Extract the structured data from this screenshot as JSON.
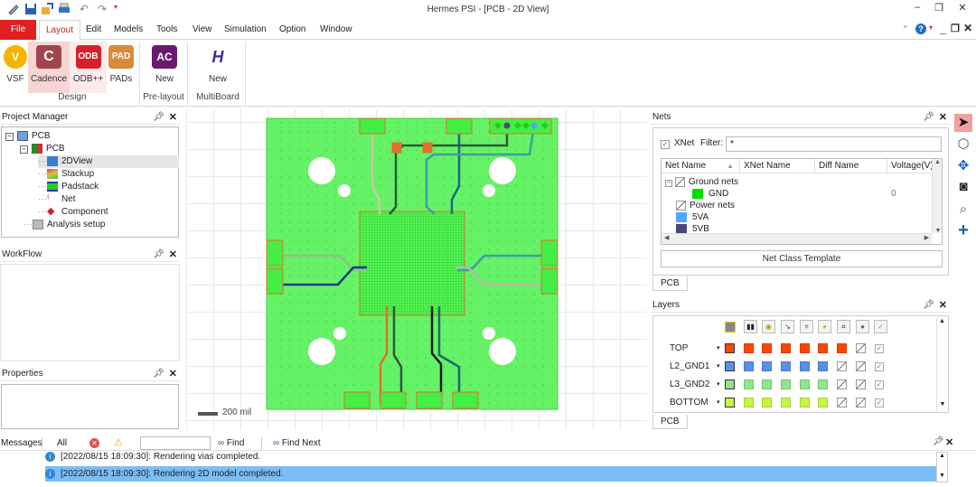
{
  "window": {
    "title": "Hermes PSI - [PCB - 2D View]",
    "minimize": "–",
    "restore": "❐",
    "close": "✕"
  },
  "quick_access": [
    "open-icon",
    "save-icon",
    "import-icon",
    "print-icon",
    "undo-icon",
    "redo-icon",
    "customize-icon"
  ],
  "menu": {
    "file": "File",
    "items": [
      "Layout",
      "Edit",
      "Models",
      "Tools",
      "View",
      "Simulation",
      "Option",
      "Window"
    ],
    "active": "Layout"
  },
  "ribbon": {
    "design": {
      "label": "Design",
      "buttons": [
        {
          "label": "VSF",
          "glyph": "V",
          "color": "#f4b400"
        },
        {
          "label": "Cadence",
          "glyph": "C",
          "color": "#a0454f"
        },
        {
          "label": "ODB++",
          "glyph": "ODB",
          "color": "#d6202a"
        },
        {
          "label": "PADs",
          "glyph": "PAD",
          "color": "#d98a3a"
        }
      ]
    },
    "prelayout": {
      "label": "Pre-layout",
      "buttons": [
        {
          "label": "New",
          "glyph": "AC",
          "color": "#6a1b6e"
        }
      ]
    },
    "multiboard": {
      "label": "MultiBoard",
      "buttons": [
        {
          "label": "New",
          "glyph": "H",
          "color": "#3a2ab0"
        }
      ]
    }
  },
  "project_manager": {
    "title": "Project Manager",
    "items": [
      {
        "label": "PCB",
        "level": 0
      },
      {
        "label": "PCB",
        "level": 1
      },
      {
        "label": "2DView",
        "level": 2,
        "selected": true
      },
      {
        "label": "Stackup",
        "level": 2
      },
      {
        "label": "Padstack",
        "level": 2
      },
      {
        "label": "Net",
        "level": 2
      },
      {
        "label": "Component",
        "level": 2
      },
      {
        "label": "Analysis setup",
        "level": 1
      }
    ]
  },
  "workflow": {
    "title": "WorkFlow"
  },
  "properties": {
    "title": "Properties"
  },
  "canvas": {
    "scale_label": "200 mil"
  },
  "nets": {
    "title": "Nets",
    "xnet_label": "XNet",
    "xnet_checked": true,
    "filter_label": "Filter:",
    "filter_value": "*",
    "columns": [
      "Net Name",
      "XNet Name",
      "Diff Name",
      "Voltage(V)"
    ],
    "rows": [
      {
        "name": "Ground nets",
        "type": "group",
        "voltage": ""
      },
      {
        "name": "GND",
        "type": "net",
        "color": "#00e000",
        "voltage": "0"
      },
      {
        "name": "Power nets",
        "type": "group",
        "voltage": ""
      },
      {
        "name": "5VA",
        "type": "net",
        "color": "#4da6ff",
        "voltage": ""
      },
      {
        "name": "5VB",
        "type": "net",
        "color": "#4a4a7a",
        "voltage": ""
      }
    ],
    "template_button": "Net Class Template",
    "tab": "PCB"
  },
  "layers": {
    "title": "Layers",
    "header_icons": [
      "layer-color-icon",
      "pad-icon",
      "via-icon",
      "trace-icon",
      "shape-icon",
      "hole-icon",
      "component-icon",
      "net-icon",
      "visible-icon"
    ],
    "rows": [
      {
        "name": "TOP",
        "color": "#ff4500",
        "filled": 7
      },
      {
        "name": "L2_GND1",
        "color": "#5b8fe6",
        "filled": 6
      },
      {
        "name": "L3_GND2",
        "color": "#8fe68f",
        "filled": 6
      },
      {
        "name": "BOTTOM",
        "color": "#c6f542",
        "filled": 6
      }
    ],
    "tab": "PCB"
  },
  "right_toolbar": [
    "select-arrow-icon",
    "select-3d-icon",
    "pan-icon",
    "zoom-fit-icon",
    "zoom-window-icon",
    "add-icon"
  ],
  "messages": {
    "title": "Messages",
    "filter_all": "All",
    "find": "Find",
    "find_next": "Find Next",
    "search_value": "",
    "lines": [
      "[2022/08/15 18:09:30]: Rendering vias completed.",
      "[2022/08/15 18:09:30]: Rendering 2D model completed."
    ]
  }
}
